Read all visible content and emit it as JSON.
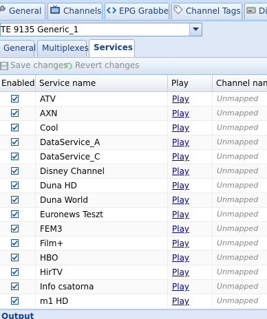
{
  "top_tabs": [
    {
      "label": "General",
      "icon": "wrench-icon"
    },
    {
      "label": "Channels",
      "icon": "tv-icon"
    },
    {
      "label": "EPG Grabber",
      "icon": "code-brackets-icon"
    },
    {
      "label": "Channel Tags",
      "icon": "tag-icon"
    },
    {
      "label": "Di",
      "icon": "disk-icon"
    }
  ],
  "adapter": {
    "value": "TE 9135 Generic_1"
  },
  "sub_tabs": [
    {
      "label": "General"
    },
    {
      "label": "Multiplexes"
    },
    {
      "label": "Services"
    }
  ],
  "toolbar": {
    "save_label": "Save changes",
    "revert_label": "Revert changes"
  },
  "grid": {
    "headers": {
      "enabled": "Enabled",
      "name": "Service name",
      "play": "Play",
      "channel": "Channel name"
    },
    "rows": [
      {
        "name": "ATV",
        "play": "Play",
        "channel": "Unmapped",
        "enabled": true
      },
      {
        "name": "AXN",
        "play": "Play",
        "channel": "Unmapped",
        "enabled": true
      },
      {
        "name": "Cool",
        "play": "Play",
        "channel": "Unmapped",
        "enabled": true
      },
      {
        "name": "DataService_A",
        "play": "Play",
        "channel": "Unmapped",
        "enabled": true
      },
      {
        "name": "DataService_C",
        "play": "Play",
        "channel": "Unmapped",
        "enabled": true
      },
      {
        "name": "Disney Channel",
        "play": "Play",
        "channel": "Unmapped",
        "enabled": true
      },
      {
        "name": "Duna HD",
        "play": "Play",
        "channel": "Unmapped",
        "enabled": true
      },
      {
        "name": "Duna World",
        "play": "Play",
        "channel": "Unmapped",
        "enabled": true
      },
      {
        "name": "Euronews Teszt",
        "play": "Play",
        "channel": "Unmapped",
        "enabled": true
      },
      {
        "name": "FEM3",
        "play": "Play",
        "channel": "Unmapped",
        "enabled": true
      },
      {
        "name": "Film+",
        "play": "Play",
        "channel": "Unmapped",
        "enabled": true
      },
      {
        "name": "HBO",
        "play": "Play",
        "channel": "Unmapped",
        "enabled": true
      },
      {
        "name": "HirTV",
        "play": "Play",
        "channel": "Unmapped",
        "enabled": true
      },
      {
        "name": "Info csatorna",
        "play": "Play",
        "channel": "Unmapped",
        "enabled": true
      },
      {
        "name": "m1 HD",
        "play": "Play",
        "channel": "Unmapped",
        "enabled": true
      }
    ]
  },
  "bottom": {
    "title": "Output"
  },
  "colors": {
    "accent": "#15428b",
    "link": "#00007f",
    "panel_bg": "#dfe8f6",
    "border": "#99bbe8"
  }
}
